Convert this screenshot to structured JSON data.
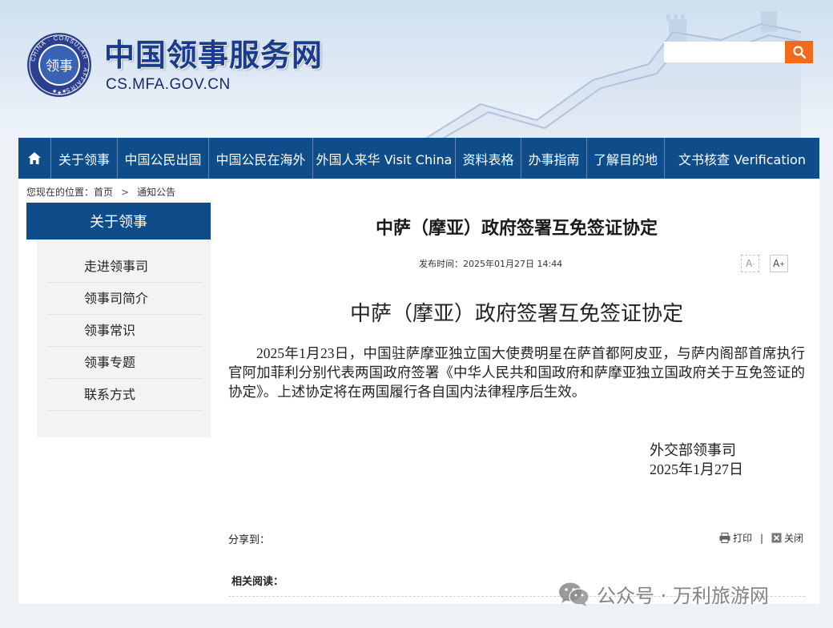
{
  "header": {
    "site_title": "中国领事服务网",
    "site_domain": "CS.MFA.GOV.CN",
    "logo": {
      "ring_text": "CHINA · CONSULAR · AFFAIRS",
      "center_text": "领事"
    },
    "search": {
      "value": "",
      "placeholder": ""
    }
  },
  "nav": {
    "items": [
      {
        "label": "关于领事"
      },
      {
        "label": "中国公民出国"
      },
      {
        "label": "中国公民在海外"
      },
      {
        "label": "外国人来华 Visit China"
      },
      {
        "label": "资料表格"
      },
      {
        "label": "办事指南"
      },
      {
        "label": "了解目的地"
      },
      {
        "label": "文书核查 Verification"
      }
    ]
  },
  "breadcrumb": {
    "prefix": "您现在的位置：",
    "home": "首页",
    "separator": ">",
    "current": "通知公告"
  },
  "sidebar": {
    "title": "关于领事",
    "items": [
      {
        "label": "走进领事司"
      },
      {
        "label": "领事司简介"
      },
      {
        "label": "领事常识"
      },
      {
        "label": "领事专题"
      },
      {
        "label": "联系方式"
      }
    ]
  },
  "article": {
    "title": "中萨（摩亚）政府签署互免签证协定",
    "pub_label": "发布时间：",
    "pub_time": "2025年01月27日  14:44",
    "font_smaller": "A",
    "font_larger": "A",
    "content_title": "中萨（摩亚）政府签署互免签证协定",
    "paragraph": "2025年1月23日，中国驻萨摩亚独立国大使费明星在萨首都阿皮亚，与萨内阁部首席执行官阿加菲利分别代表两国政府签署《中华人民共和国政府和萨摩亚独立国政府关于互免签证的协定》。上述协定将在两国履行各自国内法律程序后生效。",
    "sign_department": "外交部领事司",
    "sign_date": "2025年1月27日"
  },
  "footer_tools": {
    "share_label": "分享到：",
    "print_label": "打印",
    "separator": "|",
    "close_label": "关闭",
    "related_label": "相关阅读："
  },
  "watermark": {
    "text": "公众号 · 万利旅游网"
  },
  "colors": {
    "nav_bg": "#0e4c8a",
    "search_button": "#f26a1b",
    "site_title": "#1b3b8c"
  },
  "icons": {
    "home": "home-icon",
    "search": "search-icon",
    "print": "print-icon",
    "close": "close-icon",
    "wechat": "wechat-icon"
  }
}
